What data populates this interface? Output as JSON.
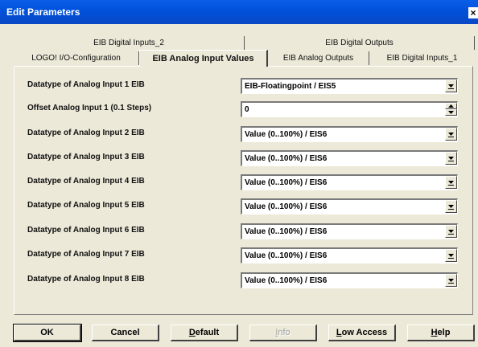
{
  "window": {
    "title": "Edit Parameters",
    "close": "×"
  },
  "tabs_back": [
    {
      "label": "EIB Digital Inputs_2"
    },
    {
      "label": "EIB Digital Outputs"
    }
  ],
  "tabs_front": [
    {
      "label": "LOGO! I/O-Configuration"
    },
    {
      "label": "EIB Analog Input Values"
    },
    {
      "label": "EIB Analog Outputs"
    },
    {
      "label": "EIB Digital Inputs_1"
    }
  ],
  "active_tab": "EIB Analog Input Values",
  "params": [
    {
      "label": "Datatype of Analog Input 1 EIB",
      "value": "EIB-Floatingpoint / EIS5",
      "control": "dropdown"
    },
    {
      "label": "Offset Analog Input 1 (0.1 Steps)",
      "value": "0",
      "control": "spinner"
    },
    {
      "label": "Datatype of Analog Input 2 EIB",
      "value": "Value (0..100%) / EIS6",
      "control": "dropdown"
    },
    {
      "label": "Datatype of Analog Input 3 EIB",
      "value": "Value (0..100%) / EIS6",
      "control": "dropdown"
    },
    {
      "label": "Datatype of Analog Input 4 EIB",
      "value": "Value (0..100%) / EIS6",
      "control": "dropdown"
    },
    {
      "label": "Datatype of Analog Input 5 EIB",
      "value": "Value (0..100%) / EIS6",
      "control": "dropdown"
    },
    {
      "label": "Datatype of Analog Input 6 EIB",
      "value": "Value (0..100%) / EIS6",
      "control": "dropdown"
    },
    {
      "label": "Datatype of Analog Input 7 EIB",
      "value": "Value (0..100%) / EIS6",
      "control": "dropdown"
    },
    {
      "label": "Datatype of Analog Input 8 EIB",
      "value": "Value (0..100%) / EIS6",
      "control": "dropdown"
    }
  ],
  "buttons": [
    {
      "pre": "",
      "u": "",
      "post": "OK",
      "enabled": true
    },
    {
      "pre": "",
      "u": "",
      "post": "Cancel",
      "enabled": true
    },
    {
      "pre": "",
      "u": "D",
      "post": "efault",
      "enabled": true
    },
    {
      "pre": "",
      "u": "I",
      "post": "nfo",
      "enabled": false
    },
    {
      "pre": "",
      "u": "L",
      "post": "ow Access",
      "enabled": true
    },
    {
      "pre": "",
      "u": "H",
      "post": "elp",
      "enabled": true
    }
  ],
  "colors": {
    "titlebar": "#0054e3",
    "dialog_bg": "#ece9d8"
  }
}
